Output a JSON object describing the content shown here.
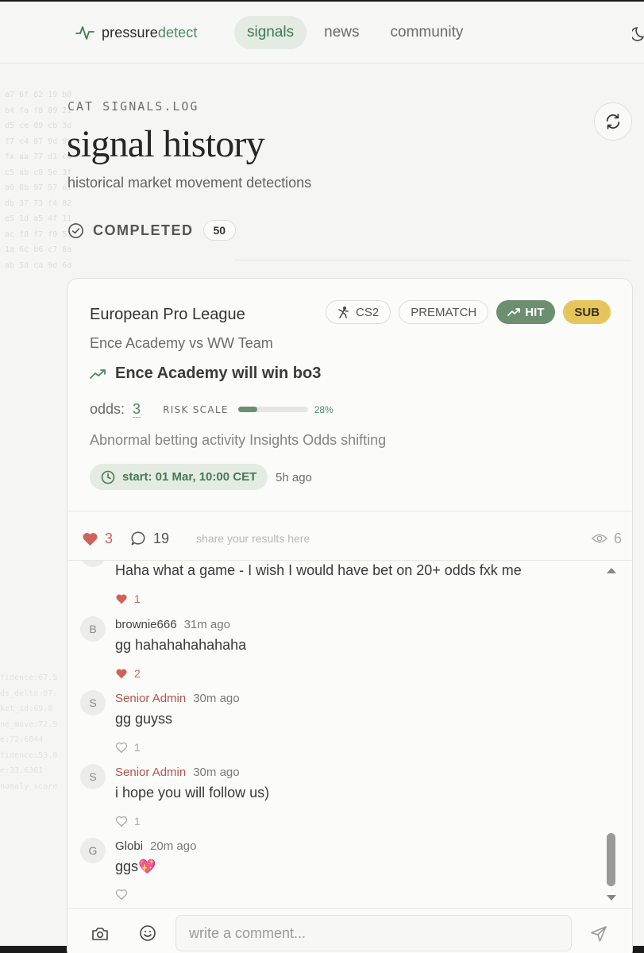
{
  "header": {
    "brand_pre": "pressure",
    "brand_acc": "detect",
    "nav": [
      {
        "label": "signals",
        "active": true
      },
      {
        "label": "news",
        "active": false
      },
      {
        "label": "community",
        "active": false
      }
    ]
  },
  "hero": {
    "eyebrow": "CAT SIGNALS.LOG",
    "title": "signal history",
    "subtitle": "historical market movement detections",
    "status_label": "COMPLETED",
    "status_count": "50"
  },
  "background_log": {
    "top": "a7 6f 82 19 b0\nb4 fa f8 89 21\nd5 ce 09 cb 3d\nf7 c4 87 9d 9a\nfx aa 77 d1 c0\nc5 ab c8 5e 3f\na0 8b 97 57 d1\ndb 37 73 f4 82\ne5 1d a5 4f 11\nac f8 f7 f0 52\n1a 6c b6 c7 8a\nab 5d ca 9d 6d",
    "bottom": "fidence:67.5\nds_delta:87.\nket_id:69.8\nne_move:72.5\ne:72.6844\nfidence:53.8\ne:33.6361\nnomaly_score"
  },
  "signal": {
    "league": "European Pro League",
    "tags": {
      "game": "CS2",
      "phase": "PREMATCH",
      "result": "HIT",
      "tier": "SUB"
    },
    "match": "Ence Academy vs WW Team",
    "prediction": "Ence Academy will win bo3",
    "odds_label": "odds:",
    "odds_value": "3",
    "risk_label": "RISK SCALE",
    "risk_pct_text": "28%",
    "risk_fraction": 0.28,
    "insights": "Abnormal betting activity Insights Odds shifting",
    "start": "start: 01 Mar, 10:00 CET",
    "posted_ago": "5h ago",
    "likes": "3",
    "comments_count": "19",
    "share_prompt": "share your results here",
    "views": "6"
  },
  "comments": [
    {
      "avatar": "",
      "author": "",
      "time": "",
      "text": "Haha what a game - I wish I would have bet on 20+ odds fxk me",
      "likes": "1",
      "liked": true,
      "admin": false
    },
    {
      "avatar": "B",
      "author": "brownie666",
      "time": "31m ago",
      "text": "gg hahahahahahaha",
      "likes": "2",
      "liked": true,
      "admin": false
    },
    {
      "avatar": "S",
      "author": "Senior Admin",
      "time": "30m ago",
      "text": "gg guyss",
      "likes": "1",
      "liked": false,
      "admin": true
    },
    {
      "avatar": "S",
      "author": "Senior Admin",
      "time": "30m ago",
      "text": "i hope you will follow us)",
      "likes": "1",
      "liked": false,
      "admin": true
    },
    {
      "avatar": "G",
      "author": "Globi",
      "time": "20m ago",
      "text": "ggs💖",
      "likes": "",
      "liked": false,
      "admin": false
    }
  ],
  "composer": {
    "placeholder": "write a comment..."
  },
  "colors": {
    "accent": "#4f8a62",
    "hit": "#6b8f6f",
    "sub": "#e6c65c",
    "like": "#d0625a",
    "admin": "#b4544c"
  }
}
